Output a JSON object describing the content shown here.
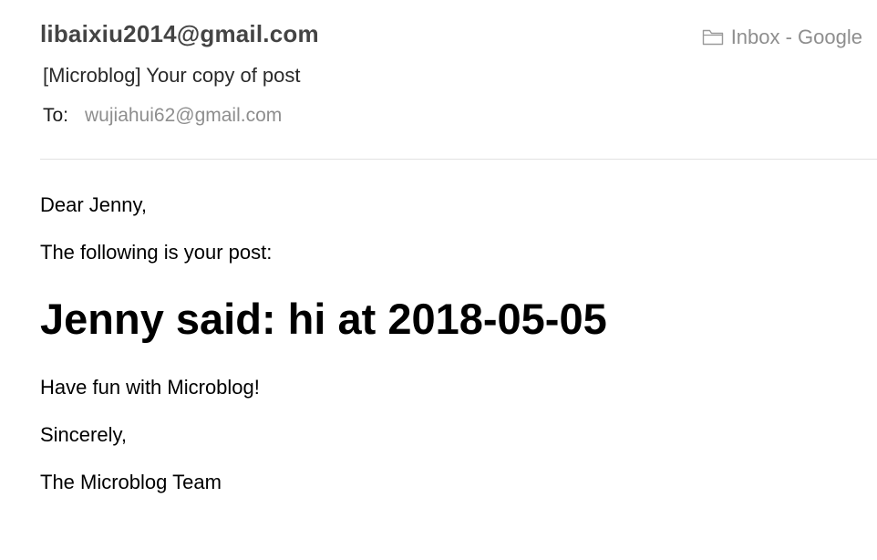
{
  "header": {
    "sender": "libaixiu2014@gmail.com",
    "mailbox": {
      "icon": "folder-icon",
      "label": "Inbox - Google"
    },
    "subject": "[Microblog] Your copy of post",
    "to_label": "To:",
    "to_address": "wujiahui62@gmail.com"
  },
  "body": {
    "greeting": "Dear Jenny,",
    "intro": "The following is your post:",
    "post": "Jenny said: hi at 2018-05-05",
    "closing_line": "Have fun with Microblog!",
    "sign_off": "Sincerely,",
    "signature": "The Microblog Team"
  },
  "colors": {
    "sender": "#444444",
    "muted": "#8e8e8e",
    "divider": "#e2e2e2",
    "text": "#000000"
  }
}
